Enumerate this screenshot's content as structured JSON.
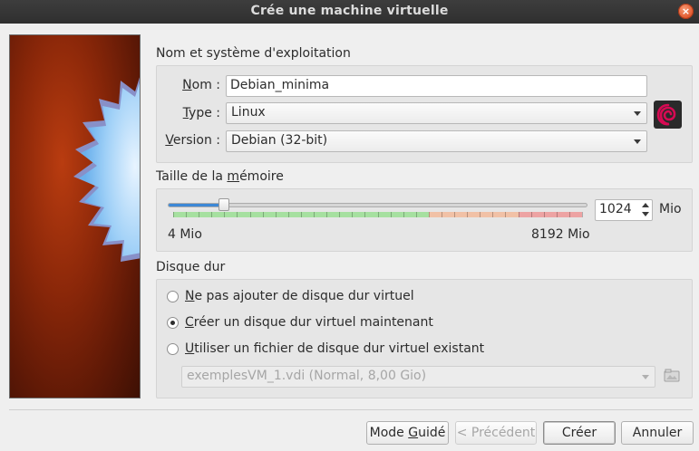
{
  "window": {
    "title": "Crée une machine virtuelle"
  },
  "name_os": {
    "section_label": "Nom et système d'exploitation",
    "name_label_prefix": "N",
    "name_label_rest": "om :",
    "name_value": "Debian_minima",
    "type_label_prefix": "T",
    "type_label_rest": "ype :",
    "type_value": "Linux",
    "version_label_prefix": "V",
    "version_label_rest": "ersion :",
    "version_value": "Debian (32-bit)",
    "os_icon": "debian-logo-icon"
  },
  "memory": {
    "section_label_pre": "Taille de la ",
    "section_label_under": "m",
    "section_label_post": "émoire",
    "value": "1024",
    "unit": "Mio",
    "min_label": "4 Mio",
    "max_label": "8192 Mio",
    "slider_fraction": 0.125,
    "colors": {
      "safe": "#a6e0a0",
      "warn": "#f1c1a6",
      "danger": "#eda3a3",
      "fill": "#3d88d6"
    }
  },
  "disk": {
    "section_label": "Disque dur",
    "options": [
      {
        "underline": "N",
        "rest": "e pas ajouter de disque dur virtuel",
        "checked": false
      },
      {
        "underline": "C",
        "rest": "réer un disque dur virtuel maintenant",
        "checked": true
      },
      {
        "underline": "U",
        "rest": "tiliser un fichier de disque dur virtuel existant",
        "checked": false
      }
    ],
    "existing_file": "exemplesVM_1.vdi (Normal, 8,00 Gio)",
    "browse_icon": "folder-icon"
  },
  "buttons": {
    "guided_pre": "Mode ",
    "guided_under": "G",
    "guided_post": "uidé",
    "previous": "< Précédent",
    "create": "Créer",
    "cancel": "Annuler"
  }
}
